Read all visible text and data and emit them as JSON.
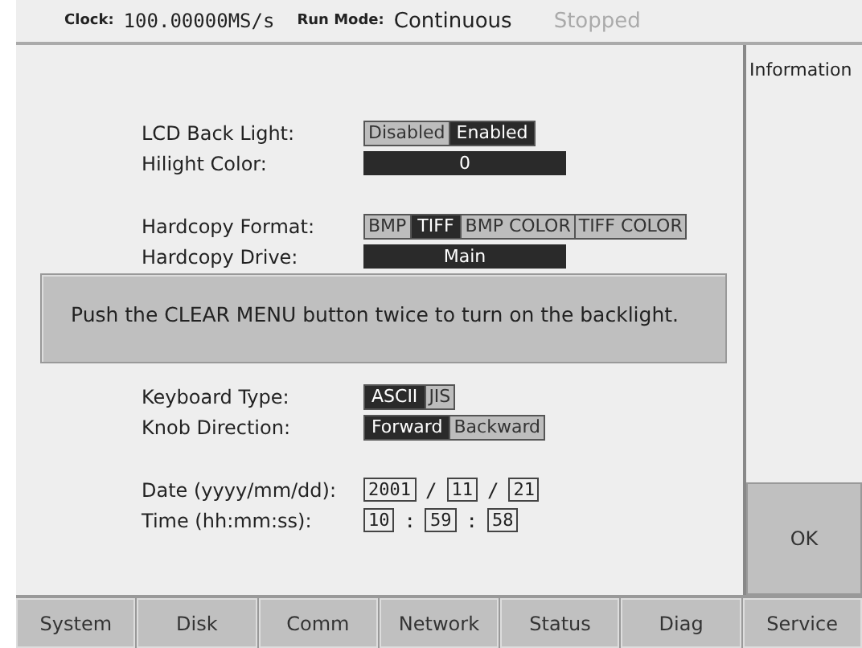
{
  "status_bar": {
    "clock_label": "Clock:",
    "clock_value": "100.00000MS/s",
    "run_mode_label": "Run Mode:",
    "run_mode_value": "Continuous",
    "state": "Stopped"
  },
  "groups": [
    {
      "rows": [
        {
          "kind": "segmented",
          "label": "LCD Back Light:",
          "options": [
            {
              "label": "Disabled",
              "selected": false
            },
            {
              "label": "Enabled",
              "selected": true
            }
          ]
        },
        {
          "kind": "bar",
          "label": "Hilight Color:",
          "value": "0"
        }
      ]
    },
    {
      "rows": [
        {
          "kind": "segmented",
          "label": "Hardcopy Format:",
          "options": [
            {
              "label": "BMP",
              "selected": false
            },
            {
              "label": "TIFF",
              "selected": true
            },
            {
              "label": "BMP COLOR",
              "selected": false
            },
            {
              "label": "TIFF COLOR",
              "selected": false
            }
          ]
        },
        {
          "kind": "bar",
          "label": "Hardcopy Drive:",
          "value": "Main"
        }
      ]
    },
    {
      "rows": [
        {
          "kind": "segmented",
          "label": "Keyboard Type:",
          "options": [
            {
              "label": "ASCII",
              "selected": true
            },
            {
              "label": "JIS",
              "selected": false
            }
          ]
        },
        {
          "kind": "segmented",
          "label": "Knob Direction:",
          "options": [
            {
              "label": "Forward",
              "selected": true
            },
            {
              "label": "Backward",
              "selected": false
            }
          ]
        }
      ]
    },
    {
      "rows": [
        {
          "kind": "fields",
          "label": "Date (yyyy/mm/dd):",
          "parts": [
            {
              "kind": "field",
              "text": "2001"
            },
            {
              "kind": "separator",
              "text": "/"
            },
            {
              "kind": "field",
              "text": "11"
            },
            {
              "kind": "separator",
              "text": "/"
            },
            {
              "kind": "field",
              "text": "21"
            }
          ]
        },
        {
          "kind": "fields",
          "label": "Time (hh:mm:ss):",
          "parts": [
            {
              "kind": "field",
              "text": "10"
            },
            {
              "kind": "separator",
              "text": ":"
            },
            {
              "kind": "field",
              "text": "59"
            },
            {
              "kind": "separator",
              "text": ":"
            },
            {
              "kind": "field",
              "text": "58"
            }
          ]
        }
      ]
    }
  ],
  "message": "Push the CLEAR MENU button twice to turn on the backlight.",
  "side_panel": {
    "title": "Information",
    "button": "OK"
  },
  "tabs": [
    {
      "label": "System",
      "selected": false
    },
    {
      "label": "Disk",
      "selected": false
    },
    {
      "label": "Comm",
      "selected": false
    },
    {
      "label": "Network",
      "selected": false
    },
    {
      "label": "Status",
      "selected": false
    },
    {
      "label": "Diag",
      "selected": false
    },
    {
      "label": "Service",
      "selected": false
    }
  ]
}
